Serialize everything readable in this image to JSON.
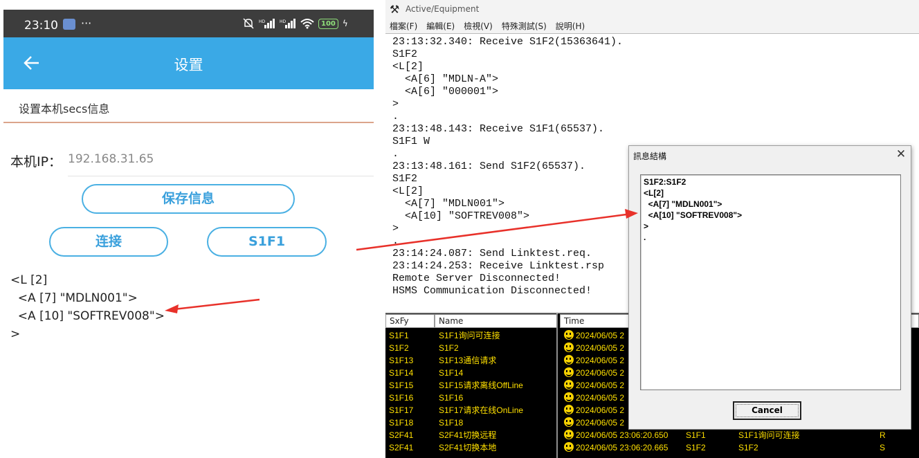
{
  "phone": {
    "status_bar": {
      "time": "23:10",
      "dots": "···",
      "battery": "100"
    },
    "app_bar": {
      "title": "设置"
    },
    "section_label": "设置本机secs信息",
    "ip_label": "本机IP：",
    "ip_value": "192.168.31.65",
    "buttons": {
      "save": "保存信息",
      "connect": "连接",
      "s1f1": "S1F1"
    },
    "result_lines": [
      "<L [2]",
      "  <A [7] \"MDLN001\">",
      "  <A [10] \"SOFTREV008\">",
      ">"
    ]
  },
  "window": {
    "title": "Active/Equipment",
    "menu": [
      "檔案(F)",
      "編輯(E)",
      "檢視(V)",
      "特殊測試(S)",
      "說明(H)"
    ],
    "log_lines": [
      "23:13:32.340: Receive S1F2(15363641).",
      "S1F2",
      "<L[2]",
      "  <A[6] \"MDLN-A\">",
      "  <A[6] \"000001\">",
      ">",
      ".",
      "23:13:48.143: Receive S1F1(65537).",
      "S1F1 W",
      ".",
      "23:13:48.161: Send S1F2(65537).",
      "S1F2",
      "<L[2]",
      "  <A[7] \"MDLN001\">",
      "  <A[10] \"SOFTREV008\">",
      ">",
      ".",
      "23:14:24.087: Send Linktest.req.",
      "23:14:24.253: Receive Linktest.rsp",
      "Remote Server Disconnected!",
      "HSMS Communication Disconnected!"
    ],
    "left_table": {
      "headers": [
        "SxFy",
        "Name"
      ],
      "rows": [
        {
          "code": "S1F1",
          "name": "S1F1询问可连接"
        },
        {
          "code": "S1F2",
          "name": "S1F2"
        },
        {
          "code": "S1F13",
          "name": "S1F13通信请求"
        },
        {
          "code": "S1F14",
          "name": "S1F14"
        },
        {
          "code": "S1F15",
          "name": "S1F15请求离线OffLine"
        },
        {
          "code": "S1F16",
          "name": "S1F16"
        },
        {
          "code": "S1F17",
          "name": "S1F17请求在线OnLine"
        },
        {
          "code": "S1F18",
          "name": "S1F18"
        },
        {
          "code": "S2F41",
          "name": "S2F41切换远程"
        },
        {
          "code": "S2F41",
          "name": "S2F41切换本地"
        }
      ]
    },
    "right_table": {
      "headers": [
        "Time"
      ],
      "rows": [
        {
          "time": "2024/06/05 2",
          "sxfy": "",
          "name": "",
          "dir": ""
        },
        {
          "time": "2024/06/05 2",
          "sxfy": "",
          "name": "",
          "dir": ""
        },
        {
          "time": "2024/06/05 2",
          "sxfy": "",
          "name": "",
          "dir": ""
        },
        {
          "time": "2024/06/05 2",
          "sxfy": "",
          "name": "",
          "dir": ""
        },
        {
          "time": "2024/06/05 2",
          "sxfy": "",
          "name": "",
          "dir": ""
        },
        {
          "time": "2024/06/05 2",
          "sxfy": "",
          "name": "",
          "dir": ""
        },
        {
          "time": "2024/06/05 2",
          "sxfy": "",
          "name": "",
          "dir": ""
        },
        {
          "time": "2024/06/05 2",
          "sxfy": "",
          "name": "",
          "dir": ""
        },
        {
          "time": "2024/06/05 23:06:20.650",
          "sxfy": "S1F1",
          "name": "S1F1询问可连接",
          "dir": "R"
        },
        {
          "time": "2024/06/05 23:06:20.665",
          "sxfy": "S1F2",
          "name": "S1F2",
          "dir": "S"
        }
      ]
    }
  },
  "dialog": {
    "title": "訊息結構",
    "close": "✕",
    "lines": [
      "S1F2:S1F2",
      "<L[2]",
      "  <A[7] \"MDLN001\">",
      "  <A[10] \"SOFTREV008\">",
      ">",
      "."
    ],
    "cancel": "Cancel"
  },
  "colors": {
    "accent": "#3aa9e6",
    "arrow": "#e8312a",
    "list_text": "#ffe000"
  }
}
